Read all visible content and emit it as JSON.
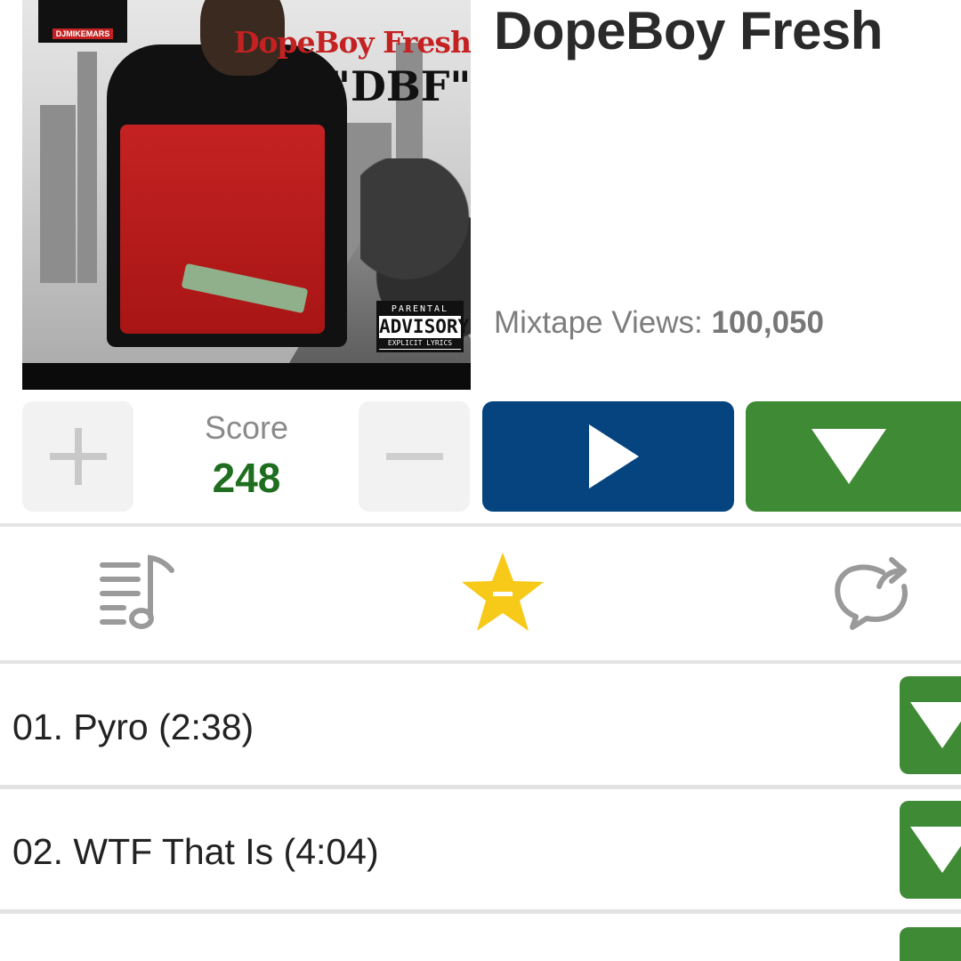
{
  "mixtape": {
    "artist": "DopeBoy Fresh",
    "views_label": "Mixtape Views:",
    "views_value": "100,050",
    "cover": {
      "artist_text": "DopeBoy Fresh",
      "album_text": "\"DBF\"",
      "badge_text": "DJMIKEMARS",
      "advisory_top": "PARENTAL",
      "advisory_main": "ADVISORY",
      "advisory_bottom": "EXPLICIT LYRICS"
    }
  },
  "score": {
    "label": "Score",
    "value": "248"
  },
  "icons": {
    "vote_up": "plus-icon",
    "vote_down": "minus-icon",
    "play": "play-icon",
    "download": "download-icon",
    "tracklist": "tracklist-icon",
    "favorite": "star-icon",
    "share": "share-icon"
  },
  "colors": {
    "play_button": "#05447e",
    "download_button": "#3f8a34",
    "score_value": "#1f6e1f",
    "favorite_star": "#f7c918"
  },
  "tracks": [
    {
      "title": "01. Pyro (2:38)"
    },
    {
      "title": "02. WTF That Is (4:04)"
    }
  ]
}
